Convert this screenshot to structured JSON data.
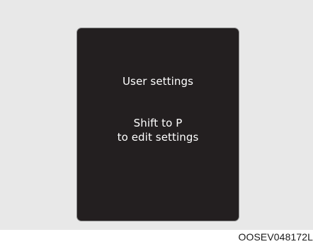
{
  "display": {
    "title": "User settings",
    "message_line1": "Shift to P",
    "message_line2": "to edit settings"
  },
  "figure_code": "OOSEV048172L"
}
